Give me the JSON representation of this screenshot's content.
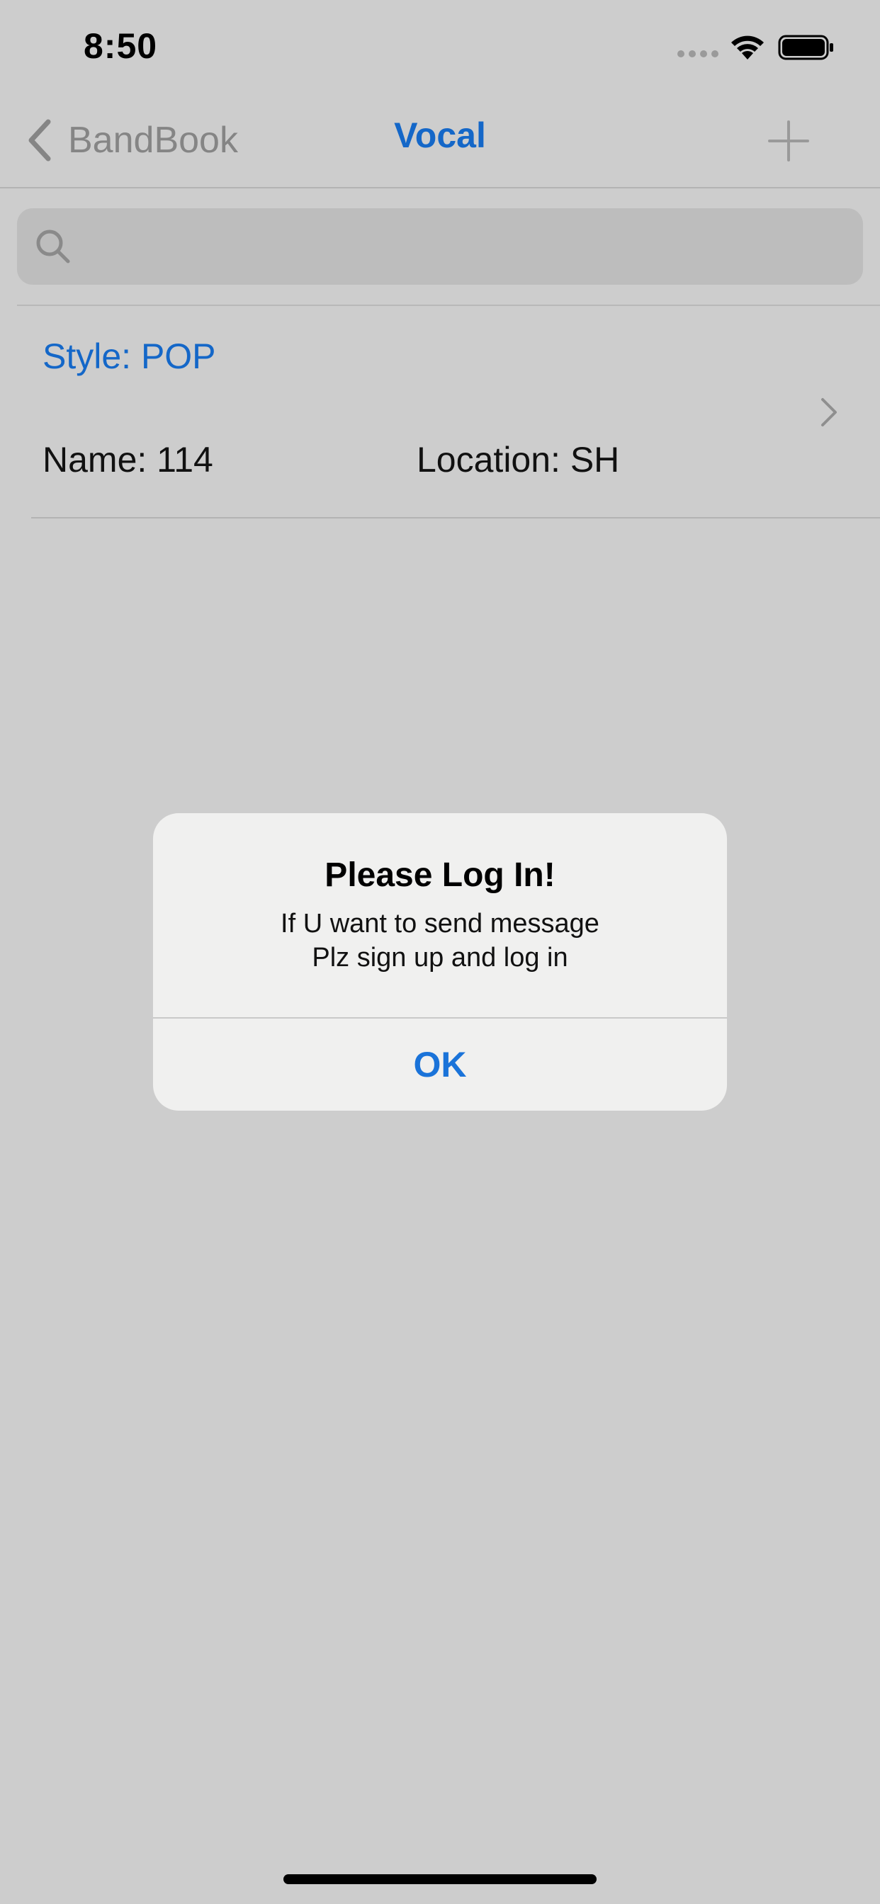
{
  "status_bar": {
    "time": "8:50"
  },
  "nav": {
    "back_label": "BandBook",
    "title": "Vocal",
    "add_icon": "plus-icon",
    "back_icon": "chevron-left-icon"
  },
  "search": {
    "placeholder": "",
    "value": ""
  },
  "list": {
    "items": [
      {
        "style_label": "Style:  POP",
        "name_label": "Name:  114",
        "location_label": "Location:  SH"
      }
    ]
  },
  "alert": {
    "title": "Please Log In!",
    "message_line1": "If U want to send message",
    "message_line2": "Plz sign up and log in",
    "ok_label": "OK"
  },
  "colors": {
    "accent": "#1467c8",
    "background_dimmed": "#cdcdcd",
    "alert_background": "#f0f0ef"
  }
}
